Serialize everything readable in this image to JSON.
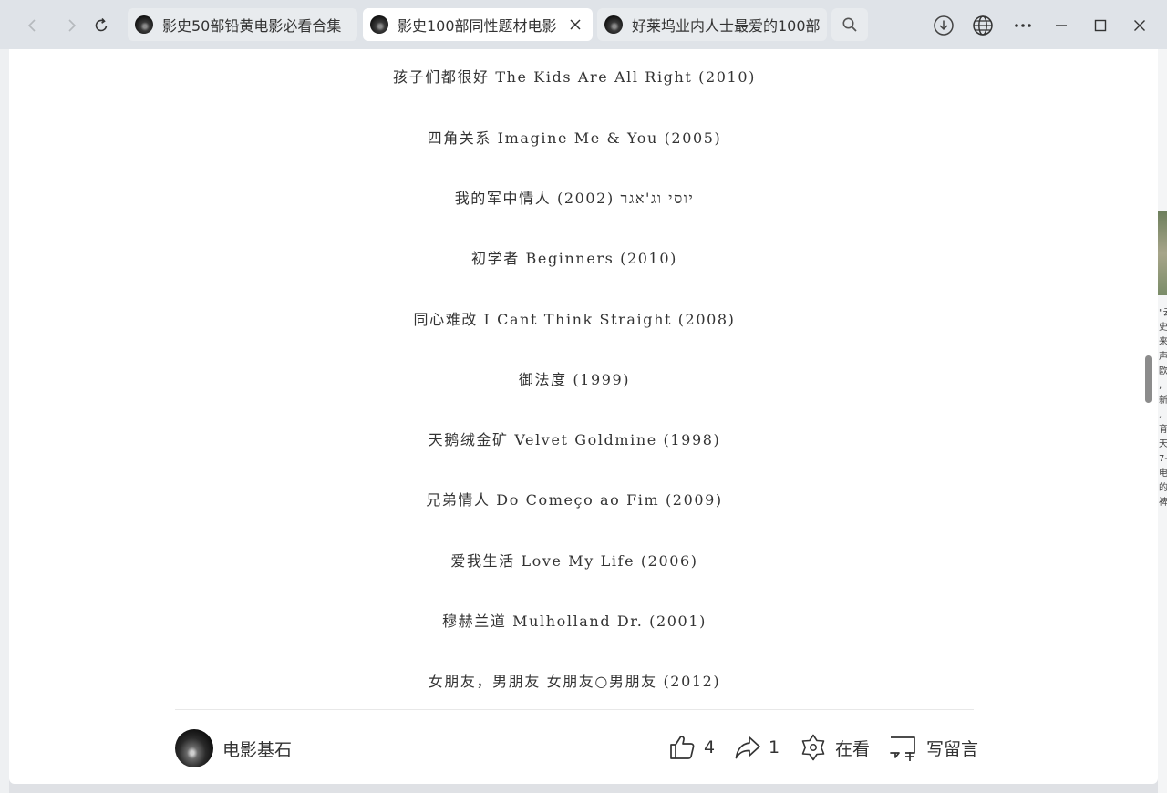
{
  "browser": {
    "tabs": [
      {
        "label": "影史50部铅黄电影必看合集",
        "active": false
      },
      {
        "label": "影史100部同性题材电影",
        "active": true
      },
      {
        "label": "好莱坞业内人士最爱的100部",
        "active": false
      }
    ],
    "icons": {
      "back": "chevron-left-icon",
      "forward": "chevron-right-icon",
      "reload": "reload-icon",
      "search": "search-icon",
      "download": "download-icon",
      "translate": "globe-icon",
      "menu": "more-icon",
      "minimize": "minimize-icon",
      "maximize": "maximize-icon",
      "close": "close-icon"
    }
  },
  "article": {
    "movies": [
      "孩子们都很好 The Kids Are All Right (2010)",
      "四角关系 Imagine Me & You (2005)",
      "我的军中情人 (2002) יוסי וג'אגר",
      "初学者 Beginners (2010)",
      "同心难改 I Cant Think Straight (2008)",
      "御法度 (1999)",
      "天鹅绒金矿 Velvet Goldmine (1998)",
      "兄弟情人 Do Começo ao Fim (2009)",
      "爱我生活 Love My Life (2006)",
      "穆赫兰道 Mulholland Dr. (2001)",
      "女朋友，男朋友 女朋友○男朋友 (2012)"
    ]
  },
  "footer": {
    "author": "电影基石",
    "like_count": "4",
    "share_count": "1",
    "watching_label": "在看",
    "comment_label": "写留言"
  },
  "background_window": {
    "side_text": "\"云 史 来 声 欧 , 新 , 育 天 7- 电 的 裨"
  }
}
